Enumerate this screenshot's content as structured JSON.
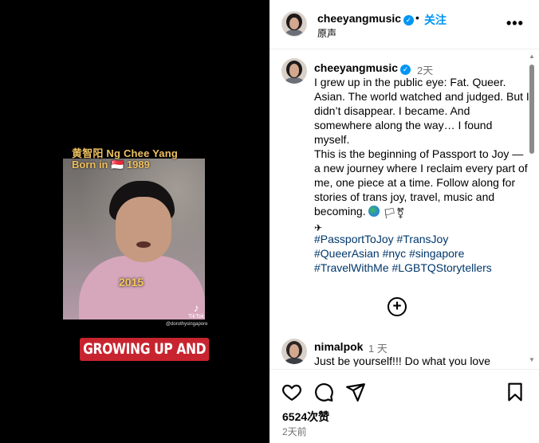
{
  "media": {
    "overlay_title": "黄智阳 Ng Chee Yang",
    "overlay_born": "Born in 🇸🇬 1989",
    "overlay_year": "2015",
    "tiktok_label": "TikTok",
    "tiktok_handle": "@dorothysingapore",
    "caption_banner": "GROWING UP AND"
  },
  "header": {
    "username": "cheeyangmusic",
    "dot": "•",
    "follow_label": "关注",
    "audio_label": "原声",
    "more_label": "•••"
  },
  "post": {
    "username": "cheeyangmusic",
    "time": "2天",
    "caption_lines": [
      "I grew up in the public eye: Fat. Queer. Asian. The world watched and judged. But I didn’t disappear. I became. And somewhere along the way… I found myself.",
      "This is the beginning of Passport to Joy — a new journey where I reclaim every part of me, one piece at a time. Follow along for stories of trans joy, travel, music and becoming."
    ],
    "hashtags": [
      "#PassportToJoy",
      "#TransJoy",
      "#QueerAsian",
      "#nyc",
      "#singapore",
      "#TravelWithMe",
      "#LGBTQStorytellers"
    ],
    "icons": [
      "globe-icon",
      "trans-flag-icon",
      "transgender-symbol-icon",
      "airplane-icon"
    ]
  },
  "load_more_label": "+",
  "comment": {
    "username": "nimalpok",
    "time": "1 天",
    "text": "Just be yourself!!! Do what you love"
  },
  "footer": {
    "likes": "6524次赞",
    "date": "2天前"
  },
  "colors": {
    "accent": "#0095f6",
    "hashtag": "#00376b",
    "banner": "#c8242f",
    "media_bg": "#000000"
  }
}
